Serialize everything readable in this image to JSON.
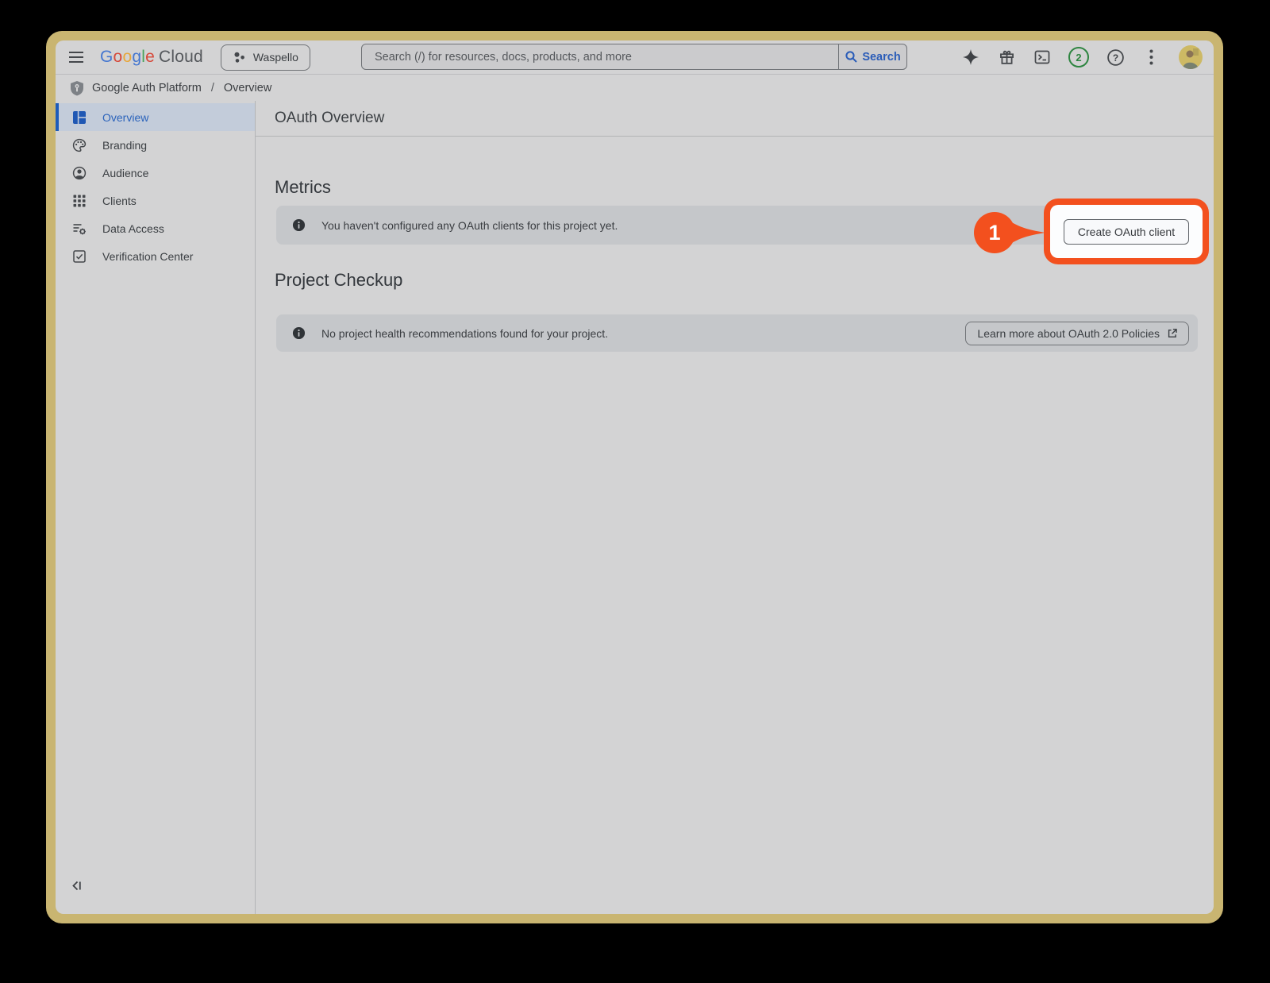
{
  "header": {
    "logo_google": "Google",
    "logo_cloud": "Cloud",
    "project_name": "Waspello",
    "search_placeholder": "Search (/) for resources, docs, products, and more",
    "search_button": "Search",
    "notification_count": "2"
  },
  "breadcrumb": {
    "section": "Google Auth Platform",
    "separator": "/",
    "current": "Overview"
  },
  "sidebar": {
    "items": [
      {
        "label": "Overview",
        "icon": "dashboard-icon",
        "selected": true
      },
      {
        "label": "Branding",
        "icon": "palette-icon",
        "selected": false
      },
      {
        "label": "Audience",
        "icon": "person-icon",
        "selected": false
      },
      {
        "label": "Clients",
        "icon": "apps-grid-icon",
        "selected": false
      },
      {
        "label": "Data Access",
        "icon": "list-settings-icon",
        "selected": false
      },
      {
        "label": "Verification Center",
        "icon": "checkbox-icon",
        "selected": false
      }
    ]
  },
  "main": {
    "page_title": "OAuth Overview",
    "sections": {
      "metrics": {
        "heading": "Metrics",
        "info_text": "You haven't configured any OAuth clients for this project yet.",
        "action_button": "Create OAuth client"
      },
      "project_checkup": {
        "heading": "Project Checkup",
        "info_text": "No project health recommendations found for your project.",
        "link_button": "Learn more about OAuth 2.0 Policies"
      }
    }
  },
  "annotation": {
    "step": "1"
  },
  "colors": {
    "frame_gold": "#c9b571",
    "annotation_orange": "#f3501e",
    "accent_blue": "#2b63bb",
    "badge_green": "#2d8540",
    "banner_gray": "#c5c7ca"
  }
}
